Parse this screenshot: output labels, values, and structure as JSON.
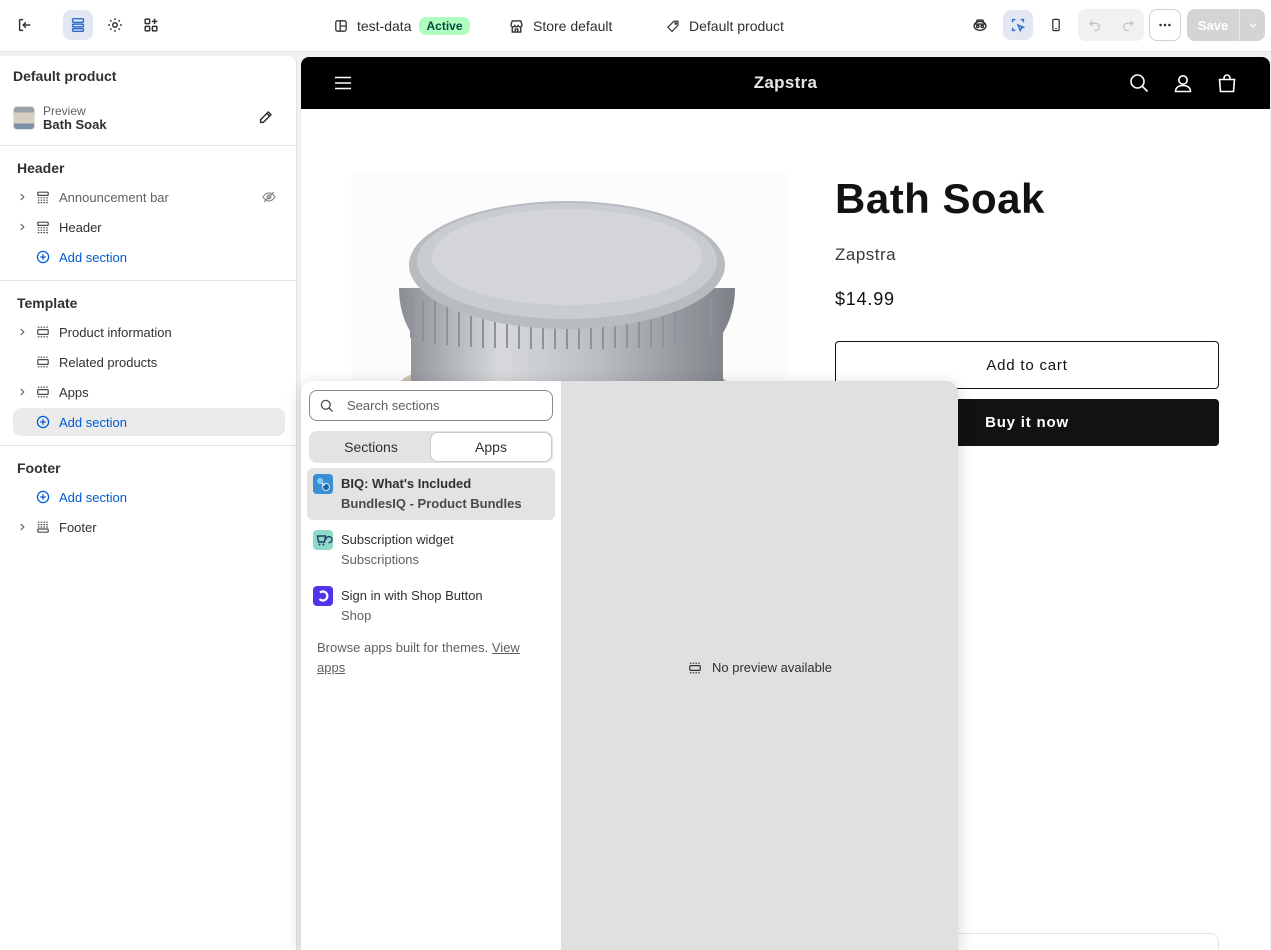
{
  "topbar": {
    "theme_name": "test-data",
    "theme_status": "Active",
    "store_label": "Store default",
    "template_label": "Default product",
    "save_label": "Save"
  },
  "sidebar": {
    "title": "Default product",
    "preview_label": "Preview",
    "preview_value": "Bath Soak",
    "header_group": {
      "title": "Header",
      "items": [
        "Announcement bar",
        "Header"
      ],
      "add_label": "Add section"
    },
    "template_group": {
      "title": "Template",
      "items": [
        "Product information",
        "Related products",
        "Apps"
      ],
      "add_label": "Add section"
    },
    "footer_group": {
      "title": "Footer",
      "add_label": "Add section",
      "items": [
        "Footer"
      ]
    }
  },
  "store": {
    "logo": "Zapstra",
    "product_title": "Bath Soak",
    "vendor": "Zapstra",
    "price": "$14.99",
    "add_to_cart": "Add to cart",
    "buy_now": "Buy it now"
  },
  "popover": {
    "search_placeholder": "Search sections",
    "tabs": [
      "Sections",
      "Apps"
    ],
    "active_tab": "Apps",
    "apps": [
      {
        "name": "BIQ: What's Included",
        "provider": "BundlesIQ - Product Bundles",
        "icon": "bundlesiq-logo"
      },
      {
        "name": "Subscription widget",
        "provider": "Subscriptions",
        "icon": "subscriptions-logo"
      },
      {
        "name": "Sign in with Shop Button",
        "provider": "Shop",
        "icon": "shop-logo"
      }
    ],
    "browse_text": "Browse apps built for themes.",
    "browse_link": "View apps",
    "no_preview": "No preview available"
  },
  "colors": {
    "accent_blue": "#005bd3",
    "active_badge_bg": "#affebf",
    "store_nav_bg": "#000000",
    "buy_button_bg": "#121212"
  }
}
